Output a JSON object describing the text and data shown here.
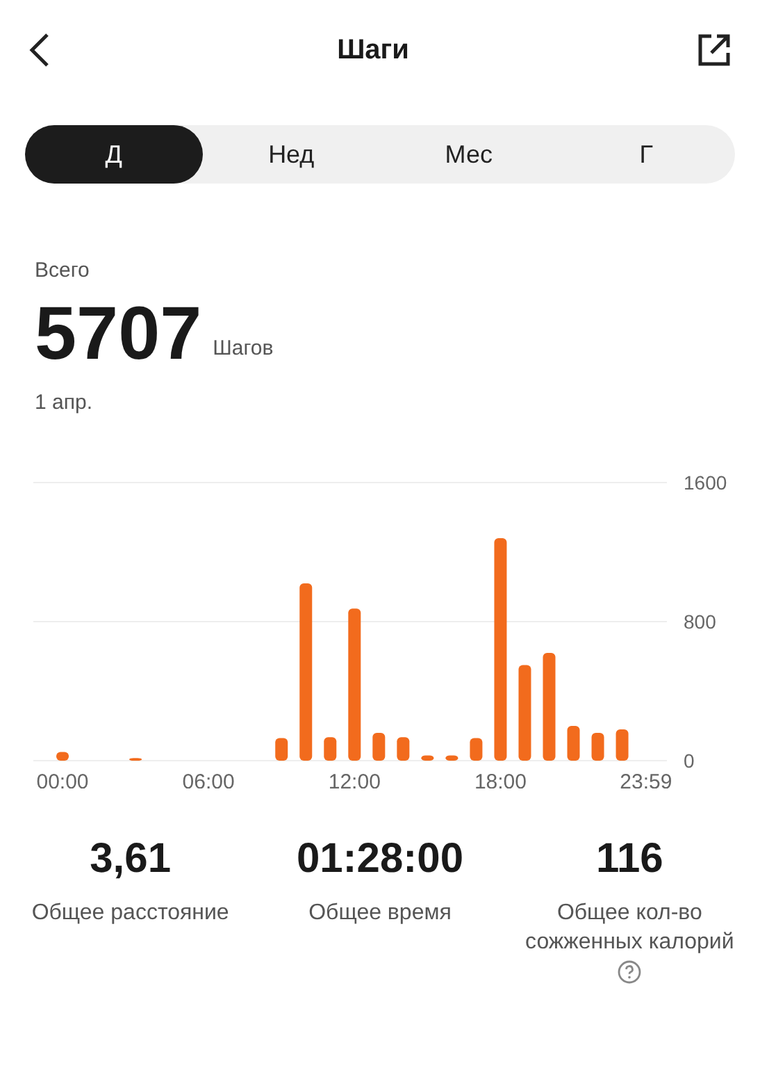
{
  "header": {
    "title": "Шаги"
  },
  "tabs": [
    {
      "label": "Д",
      "selected": true
    },
    {
      "label": "Нед",
      "selected": false
    },
    {
      "label": "Мес",
      "selected": false
    },
    {
      "label": "Г",
      "selected": false
    }
  ],
  "summary": {
    "caption": "Всего",
    "value": "5707",
    "unit": "Шагов",
    "date": "1 апр."
  },
  "chart_data": {
    "type": "bar",
    "xlim": [
      -1.2,
      24.84
    ],
    "x": [
      0,
      3,
      9,
      10,
      11,
      12,
      13,
      14,
      15,
      16,
      17,
      18,
      19,
      20,
      21,
      22,
      23
    ],
    "series": [
      {
        "color": "#f26b1d",
        "values": [
          50,
          15,
          130,
          1020,
          135,
          875,
          160,
          135,
          30,
          30,
          130,
          1280,
          550,
          620,
          200,
          160,
          180
        ]
      }
    ],
    "ylim": [
      0,
      1600
    ],
    "yticks": [
      0,
      800,
      1600
    ],
    "xticks": [
      {
        "value": 0,
        "label": "00:00"
      },
      {
        "value": 6,
        "label": "06:00"
      },
      {
        "value": 12,
        "label": "12:00"
      },
      {
        "value": 18,
        "label": "18:00"
      },
      {
        "value": 23.98,
        "label": "23:59"
      }
    ]
  },
  "stats": [
    {
      "value": "3,61",
      "label": "Общее расстояние",
      "help": false
    },
    {
      "value": "01:28:00",
      "label": "Общее время",
      "help": false
    },
    {
      "value": "116",
      "label": "Общее кол-во сожженных калорий",
      "help": true
    }
  ]
}
